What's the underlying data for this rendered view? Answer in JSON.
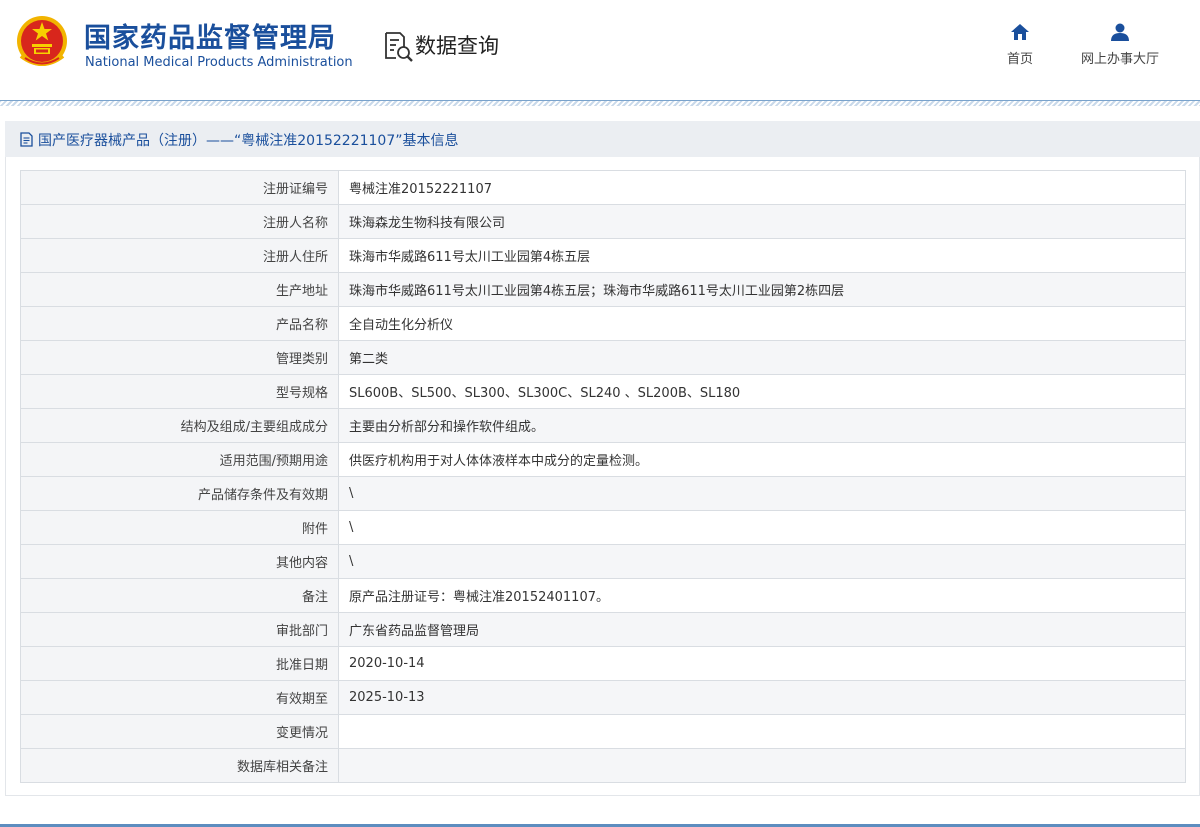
{
  "header": {
    "brand_cn": "国家药品监督管理局",
    "brand_en": "National Medical Products Administration",
    "section_title": "数据查询",
    "nav": [
      {
        "label": "首页",
        "icon": "home-icon"
      },
      {
        "label": "网上办事大厅",
        "icon": "user-icon"
      }
    ]
  },
  "page": {
    "title": "国产医疗器械产品（注册）——“粤械注准20152221107”基本信息"
  },
  "colors": {
    "brand": "#1a4f9c",
    "label_bg": "#f4f5f7",
    "border": "#d9dde2"
  },
  "rows": [
    {
      "label": "注册证编号",
      "value": "粤械注准20152221107"
    },
    {
      "label": "注册人名称",
      "value": "珠海森龙生物科技有限公司"
    },
    {
      "label": "注册人住所",
      "value": "珠海市华威路611号太川工业园第4栋五层"
    },
    {
      "label": "生产地址",
      "value": "珠海市华威路611号太川工业园第4栋五层；珠海市华威路611号太川工业园第2栋四层"
    },
    {
      "label": "产品名称",
      "value": "全自动生化分析仪"
    },
    {
      "label": "管理类别",
      "value": "第二类"
    },
    {
      "label": "型号规格",
      "value": "SL600B、SL500、SL300、SL300C、SL240 、SL200B、SL180"
    },
    {
      "label": "结构及组成/主要组成成分",
      "value": "主要由分析部分和操作软件组成。"
    },
    {
      "label": "适用范围/预期用途",
      "value": "供医疗机构用于对人体体液样本中成分的定量检测。"
    },
    {
      "label": "产品储存条件及有效期",
      "value": "\\"
    },
    {
      "label": "附件",
      "value": "\\"
    },
    {
      "label": "其他内容",
      "value": "\\"
    },
    {
      "label": "备注",
      "value": "原产品注册证号：粤械注准20152401107。"
    },
    {
      "label": "审批部门",
      "value": "广东省药品监督管理局"
    },
    {
      "label": "批准日期",
      "value": "2020-10-14"
    },
    {
      "label": "有效期至",
      "value": "2025-10-13"
    },
    {
      "label": "变更情况",
      "value": ""
    },
    {
      "label": "数据库相关备注",
      "value": ""
    }
  ]
}
